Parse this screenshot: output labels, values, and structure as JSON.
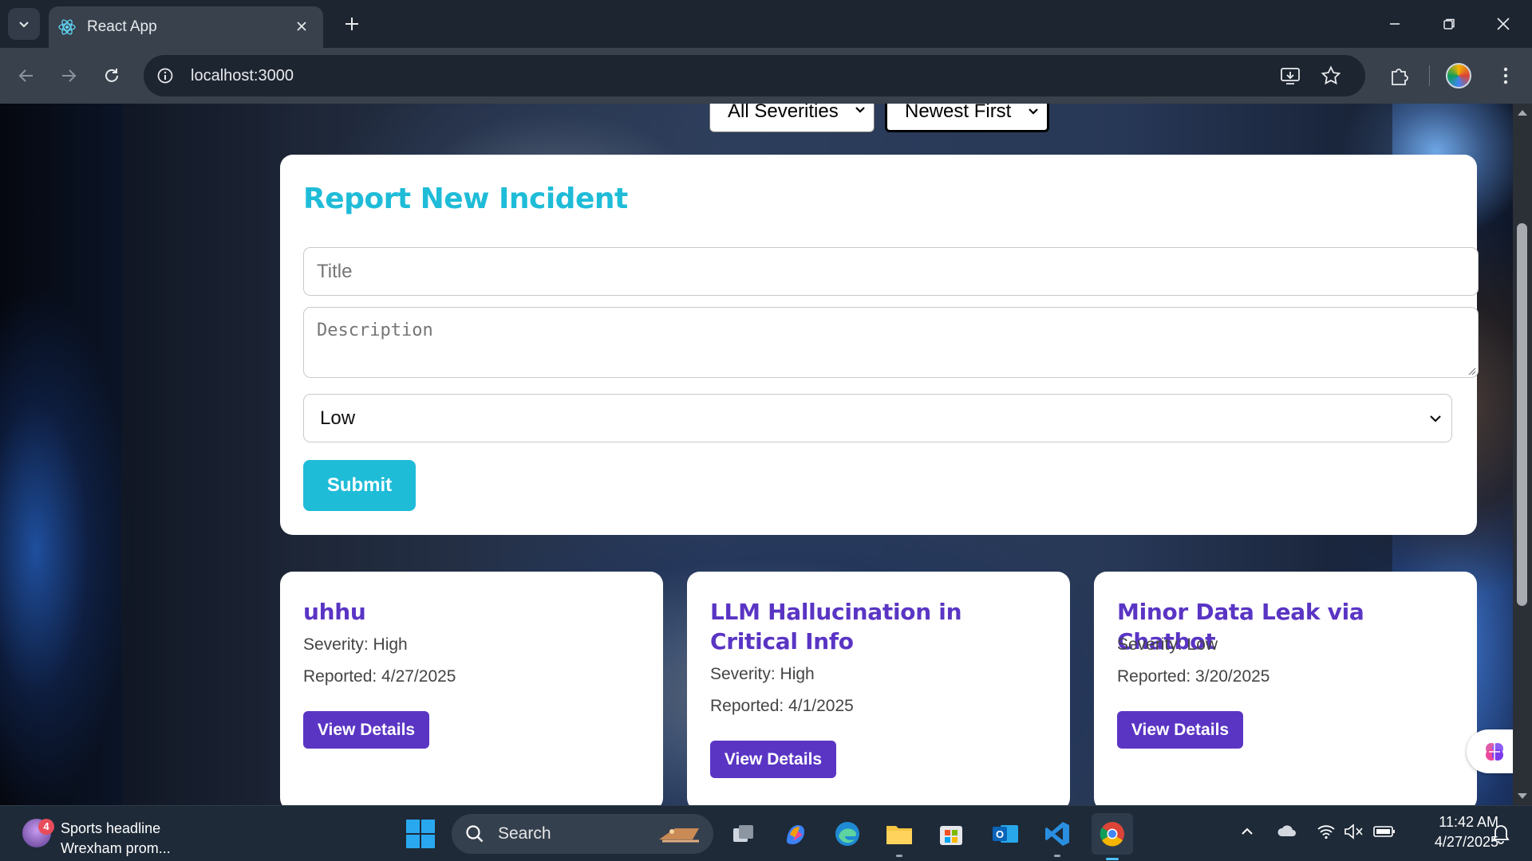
{
  "browser": {
    "tab_title": "React App",
    "url": "localhost:3000"
  },
  "page": {
    "filters": {
      "severity_filter_value": "All Severities",
      "sort_value": "Newest First"
    },
    "report_form": {
      "heading": "Report New Incident",
      "title_placeholder": "Title",
      "description_placeholder": "Description",
      "severity_value": "Low",
      "submit_label": "Submit"
    },
    "incidents": [
      {
        "title": "uhhu",
        "severity": "Severity: High",
        "reported": "Reported: 4/27/2025",
        "button": "View Details"
      },
      {
        "title": "LLM Hallucination in Critical Info",
        "severity": "Severity: High",
        "reported": "Reported: 4/1/2025",
        "button": "View Details"
      },
      {
        "title": "Minor Data Leak via Chatbot",
        "severity": "Severity: Low",
        "reported": "Reported: 3/20/2025",
        "button": "View Details"
      }
    ]
  },
  "taskbar": {
    "news_badge": "4",
    "news_title": "Sports headline",
    "news_subtitle": "Wrexham prom...",
    "search_label": "Search",
    "time": "11:42 AM",
    "date": "4/27/2025"
  },
  "colors": {
    "accent_cyan": "#1fbcd8",
    "accent_purple": "#5a35c4",
    "chrome_dark": "#1d2530",
    "chrome_mid": "#38414c"
  }
}
